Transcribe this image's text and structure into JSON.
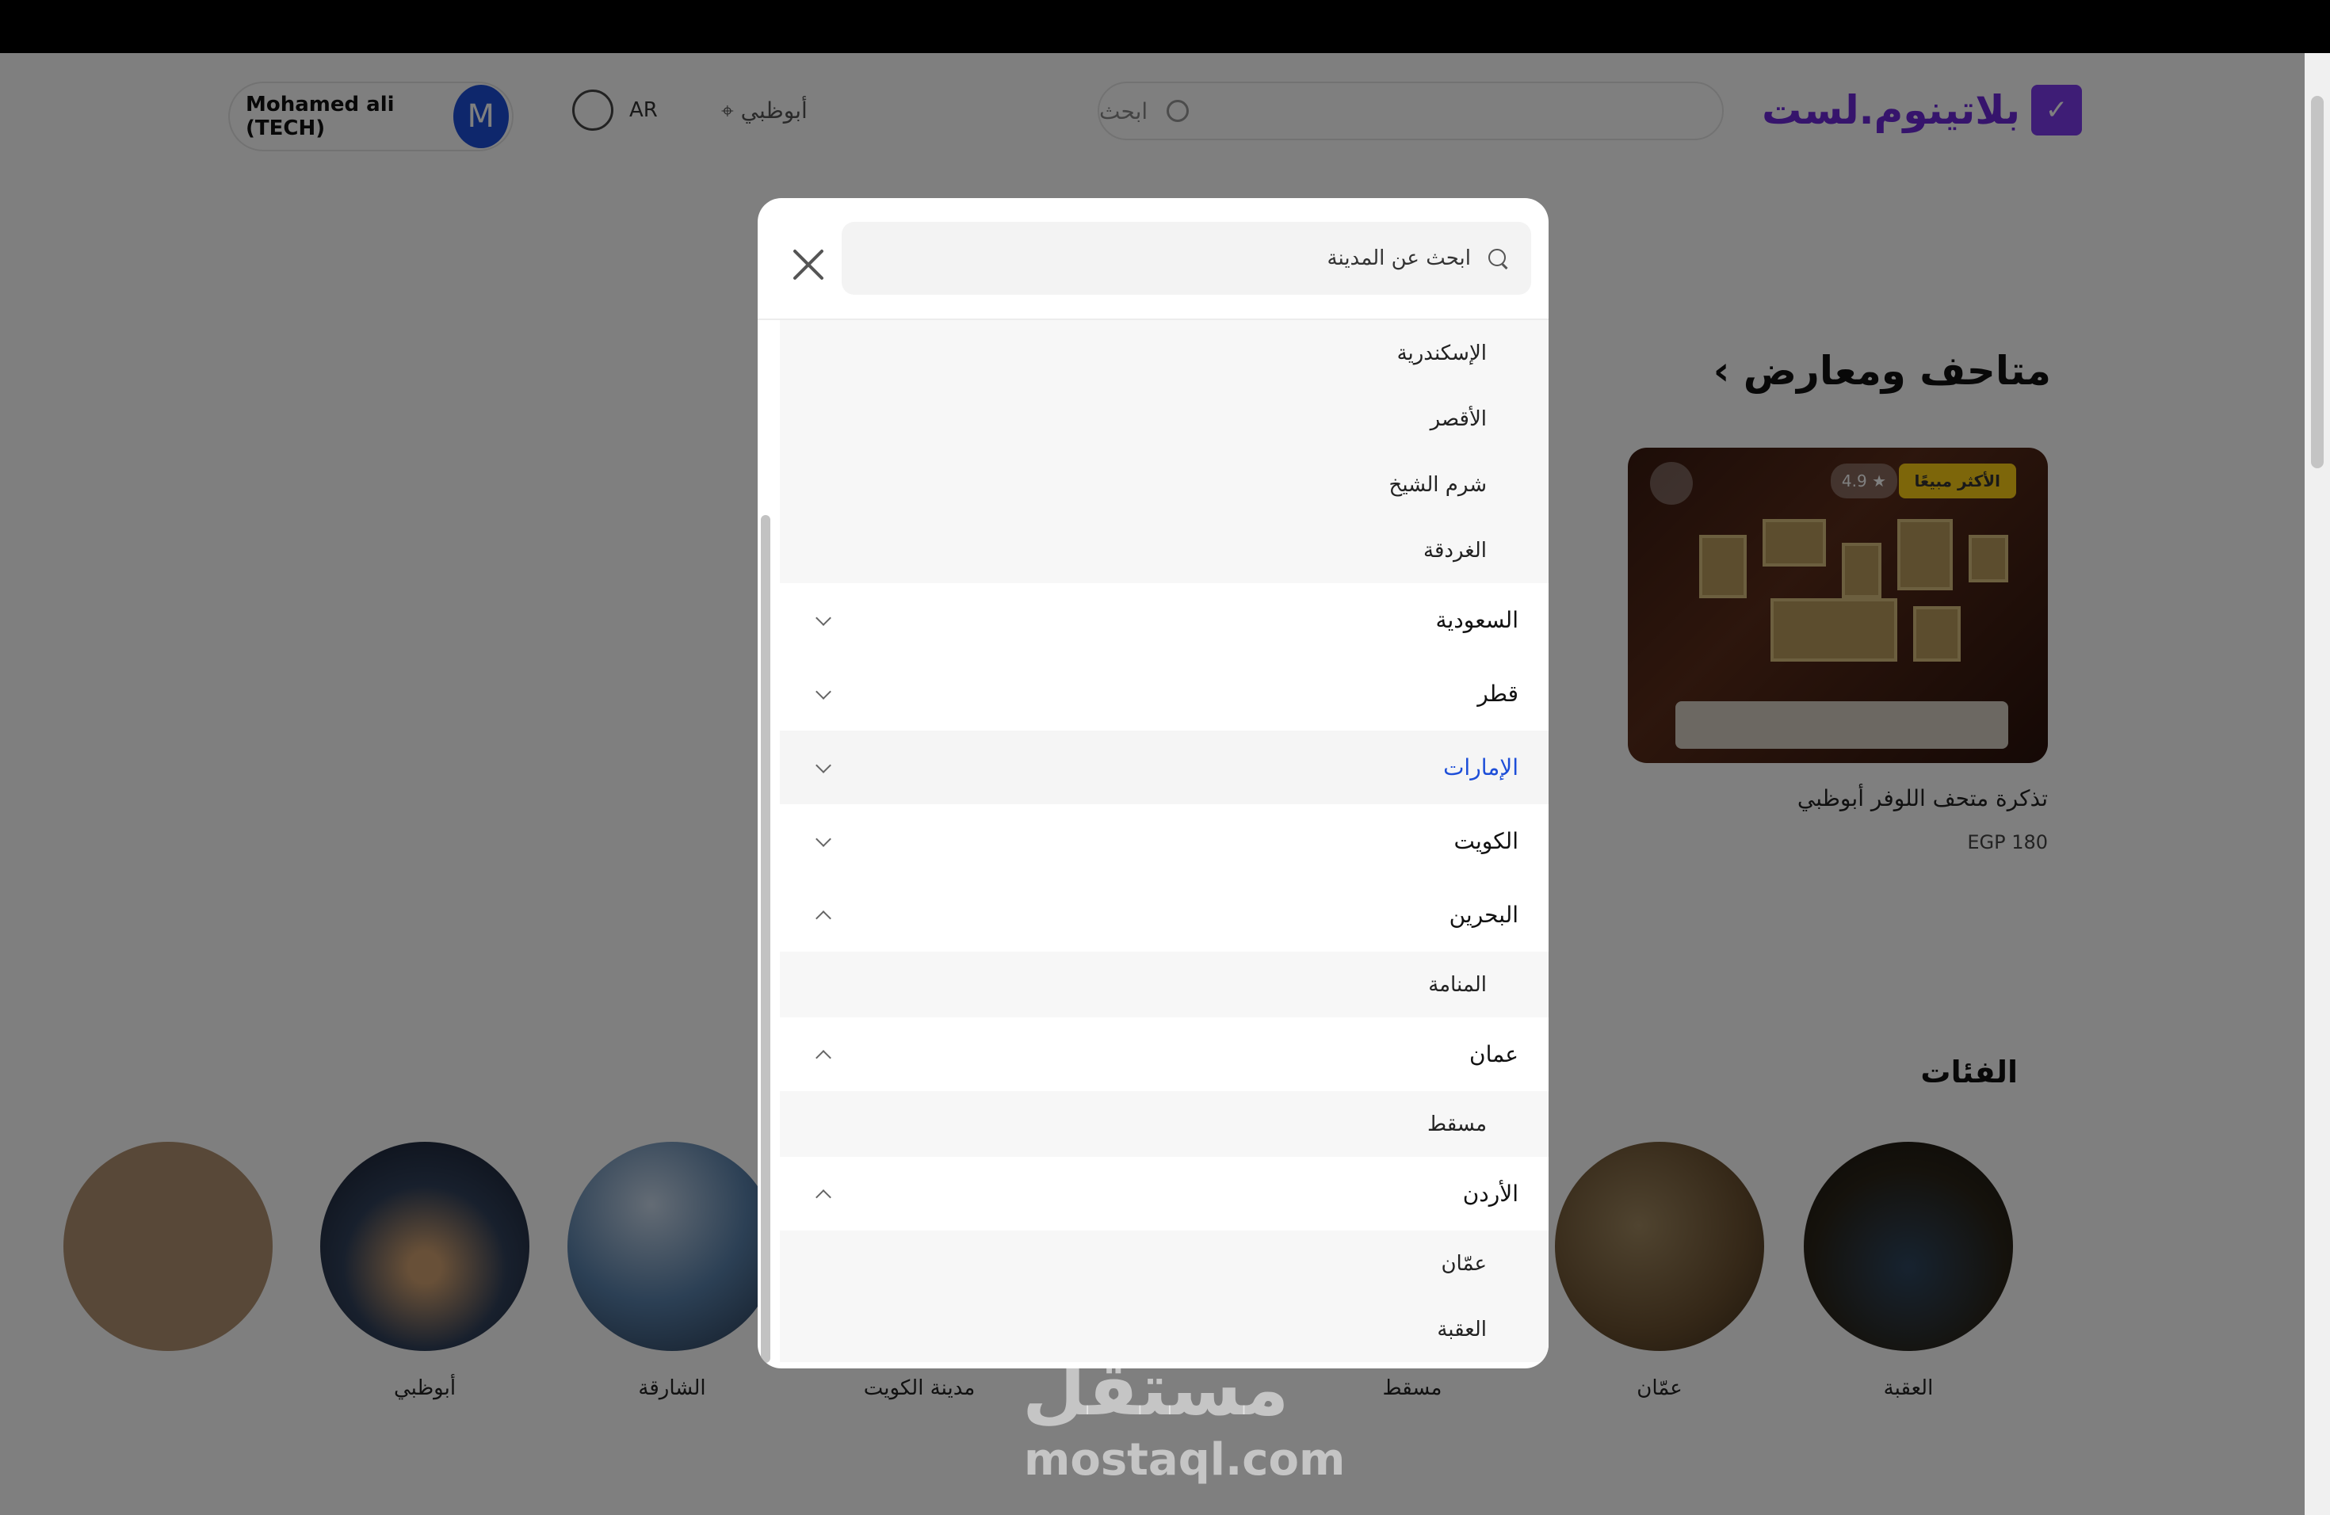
{
  "header": {
    "brand": "بلاتينوم.لست",
    "search_placeholder": "ابحث",
    "location": "أبوظبي",
    "language": "AR",
    "user_name": "Mohamed ali (TECH)",
    "user_initial": "M"
  },
  "main": {
    "section_title": "متاحف ومعارض ›",
    "card": {
      "badge": "الأكثر مبيعًا",
      "rating": "4.9 ★",
      "name": "تذكرة متحف اللوفر أبوظبي",
      "price": "EGP 180"
    },
    "categories_title": "الفئات",
    "categories": [
      {
        "label": "العقبة",
        "color": "#3a3220"
      },
      {
        "label": "عمّان",
        "color": "#7a6440"
      },
      {
        "label": "مسقط",
        "color": "#5a5048"
      },
      {
        "label": "مدينة الكويت",
        "color": "#44506a"
      },
      {
        "label": "الشارقة",
        "color": "#3a5c86"
      },
      {
        "label": "أبوظبي",
        "color": "#2b3a5a"
      }
    ]
  },
  "watermark": {
    "arabic": "مستقل",
    "latin": "mostaql.com"
  },
  "modal": {
    "search_placeholder": "ابحث عن المدينة",
    "rows": [
      {
        "type": "city",
        "label": "الإسكندرية"
      },
      {
        "type": "city",
        "label": "الأقصر"
      },
      {
        "type": "city",
        "label": "شرم الشيخ"
      },
      {
        "type": "city",
        "label": "الغردقة"
      },
      {
        "type": "country",
        "label": "السعودية",
        "expanded": false
      },
      {
        "type": "country",
        "label": "قطر",
        "expanded": false
      },
      {
        "type": "country",
        "label": "الإمارات",
        "expanded": false,
        "active": true
      },
      {
        "type": "country",
        "label": "الكويت",
        "expanded": false
      },
      {
        "type": "country",
        "label": "البحرين",
        "expanded": true
      },
      {
        "type": "city",
        "label": "المنامة"
      },
      {
        "type": "country",
        "label": "عمان",
        "expanded": true
      },
      {
        "type": "city",
        "label": "مسقط"
      },
      {
        "type": "country",
        "label": "الأردن",
        "expanded": true
      },
      {
        "type": "city",
        "label": "عمّان"
      },
      {
        "type": "city",
        "label": "العقبة"
      }
    ]
  }
}
